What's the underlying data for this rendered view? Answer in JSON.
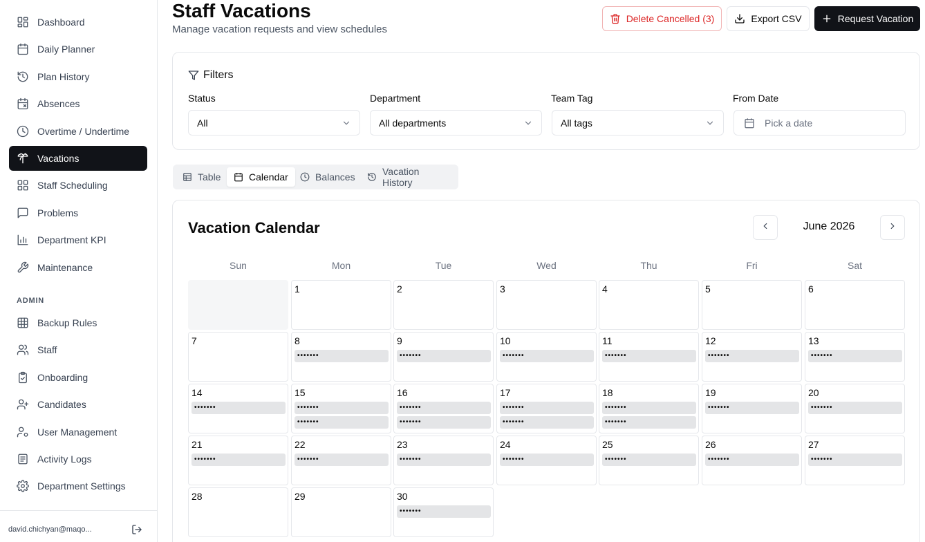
{
  "sidebar": {
    "items": [
      {
        "label": "Dashboard",
        "icon": "dashboard-grid-icon"
      },
      {
        "label": "Daily Planner",
        "icon": "calendar-icon"
      },
      {
        "label": "Plan History",
        "icon": "history-icon"
      },
      {
        "label": "Absences",
        "icon": "calendar-x-icon"
      },
      {
        "label": "Overtime / Undertime",
        "icon": "clock-icon"
      },
      {
        "label": "Vacations",
        "icon": "palm-tree-icon",
        "active": true
      },
      {
        "label": "Staff Scheduling",
        "icon": "grid-icon"
      },
      {
        "label": "Problems",
        "icon": "message-square-icon"
      },
      {
        "label": "Department KPI",
        "icon": "bar-chart-icon"
      },
      {
        "label": "Maintenance",
        "icon": "wrench-icon"
      }
    ],
    "admin_label": "ADMIN",
    "admin_items": [
      {
        "label": "Backup Rules",
        "icon": "table-icon"
      },
      {
        "label": "Staff",
        "icon": "users-icon"
      },
      {
        "label": "Onboarding",
        "icon": "clipboard-check-icon"
      },
      {
        "label": "Candidates",
        "icon": "user-plus-icon"
      },
      {
        "label": "User Management",
        "icon": "user-cog-icon"
      },
      {
        "label": "Activity Logs",
        "icon": "log-icon"
      },
      {
        "label": "Department Settings",
        "icon": "gear-icon"
      }
    ],
    "user_email": "david.chichyan@maqo..."
  },
  "header": {
    "title": "Staff Vacations",
    "subtitle": "Manage vacation requests and view schedules",
    "delete_label": "Delete Cancelled (3)",
    "export_label": "Export CSV",
    "request_label": "Request Vacation"
  },
  "filters": {
    "title": "Filters",
    "status_label": "Status",
    "status_value": "All",
    "department_label": "Department",
    "department_value": "All departments",
    "team_tag_label": "Team Tag",
    "team_tag_value": "All tags",
    "from_date_label": "From Date",
    "from_date_placeholder": "Pick a date"
  },
  "tabs": [
    {
      "label": "Table",
      "icon": "table-icon"
    },
    {
      "label": "Calendar",
      "icon": "calendar-icon",
      "active": true
    },
    {
      "label": "Balances",
      "icon": "clock-icon"
    },
    {
      "label": "Vacation History",
      "icon": "history-icon"
    }
  ],
  "calendar": {
    "title": "Vacation Calendar",
    "month": "June 2026",
    "weekdays": [
      "Sun",
      "Mon",
      "Tue",
      "Wed",
      "Thu",
      "Fri",
      "Sat"
    ],
    "first_weekday_index": 1,
    "days": [
      {
        "n": "1",
        "events": []
      },
      {
        "n": "2",
        "events": []
      },
      {
        "n": "3",
        "events": []
      },
      {
        "n": "4",
        "events": []
      },
      {
        "n": "5",
        "events": []
      },
      {
        "n": "6",
        "events": []
      },
      {
        "n": "7",
        "events": []
      },
      {
        "n": "8",
        "events": [
          "•••••••"
        ]
      },
      {
        "n": "9",
        "events": [
          "•••••••"
        ]
      },
      {
        "n": "10",
        "events": [
          "•••••••"
        ]
      },
      {
        "n": "11",
        "events": [
          "•••••••"
        ]
      },
      {
        "n": "12",
        "events": [
          "•••••••"
        ]
      },
      {
        "n": "13",
        "events": [
          "•••••••"
        ]
      },
      {
        "n": "14",
        "events": [
          "•••••••"
        ]
      },
      {
        "n": "15",
        "events": [
          "•••••••",
          "•••••••"
        ]
      },
      {
        "n": "16",
        "events": [
          "•••••••",
          "•••••••"
        ]
      },
      {
        "n": "17",
        "events": [
          "•••••••",
          "•••••••"
        ]
      },
      {
        "n": "18",
        "events": [
          "•••••••",
          "•••••••"
        ]
      },
      {
        "n": "19",
        "events": [
          "•••••••"
        ]
      },
      {
        "n": "20",
        "events": [
          "•••••••"
        ]
      },
      {
        "n": "21",
        "events": [
          "•••••••"
        ]
      },
      {
        "n": "22",
        "events": [
          "•••••••"
        ]
      },
      {
        "n": "23",
        "events": [
          "•••••••"
        ]
      },
      {
        "n": "24",
        "events": [
          "•••••••"
        ]
      },
      {
        "n": "25",
        "events": [
          "•••••••"
        ]
      },
      {
        "n": "26",
        "events": [
          "•••••••"
        ]
      },
      {
        "n": "27",
        "events": [
          "•••••••"
        ]
      },
      {
        "n": "28",
        "events": []
      },
      {
        "n": "29",
        "events": []
      },
      {
        "n": "30",
        "events": [
          "•••••••"
        ]
      }
    ]
  },
  "colors": {
    "primary": "#111318",
    "danger": "#dc2626",
    "border": "#e5e7eb",
    "event_bg": "#e4e5e7",
    "muted_text": "#6b7280"
  }
}
